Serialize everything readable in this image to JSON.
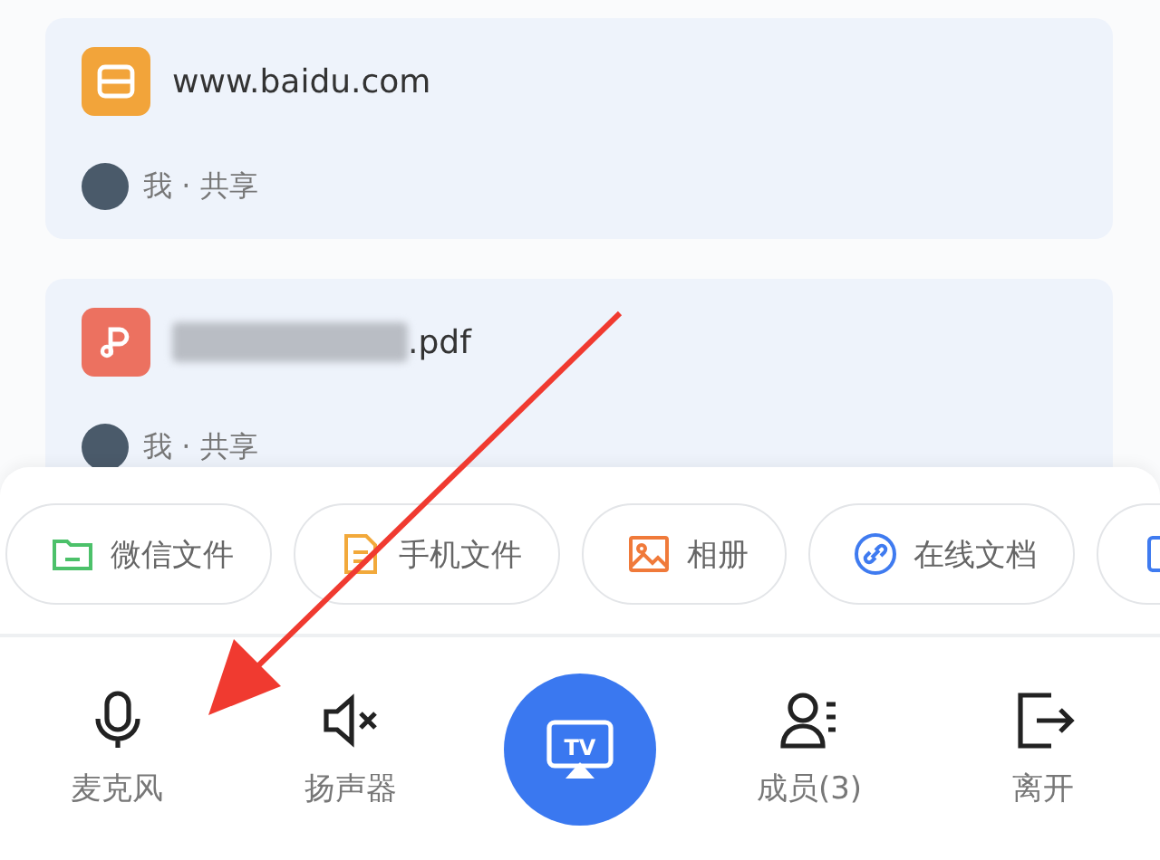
{
  "shares": [
    {
      "kind": "web",
      "title": "www.baidu.com",
      "meta": "我 · 共享"
    },
    {
      "kind": "pdf",
      "title": ".pdf",
      "redacted": true,
      "meta": "我 · 共享"
    }
  ],
  "sources": [
    {
      "kind": "folder",
      "label": "微信文件",
      "color": "#4cc16a"
    },
    {
      "kind": "file",
      "label": "手机文件",
      "color": "#f2a93b"
    },
    {
      "kind": "image",
      "label": "相册",
      "color": "#f07a3a"
    },
    {
      "kind": "link",
      "label": "在线文档",
      "color": "#3f7bf0"
    },
    {
      "kind": "more",
      "color": "#3f7bf0"
    }
  ],
  "controls": [
    {
      "kind": "mic",
      "label": "麦克风"
    },
    {
      "kind": "speaker-off",
      "label": "扬声器"
    },
    {
      "kind": "cast",
      "label": "TV"
    },
    {
      "kind": "members",
      "label": "成员(3)"
    },
    {
      "kind": "leave",
      "label": "离开"
    }
  ]
}
